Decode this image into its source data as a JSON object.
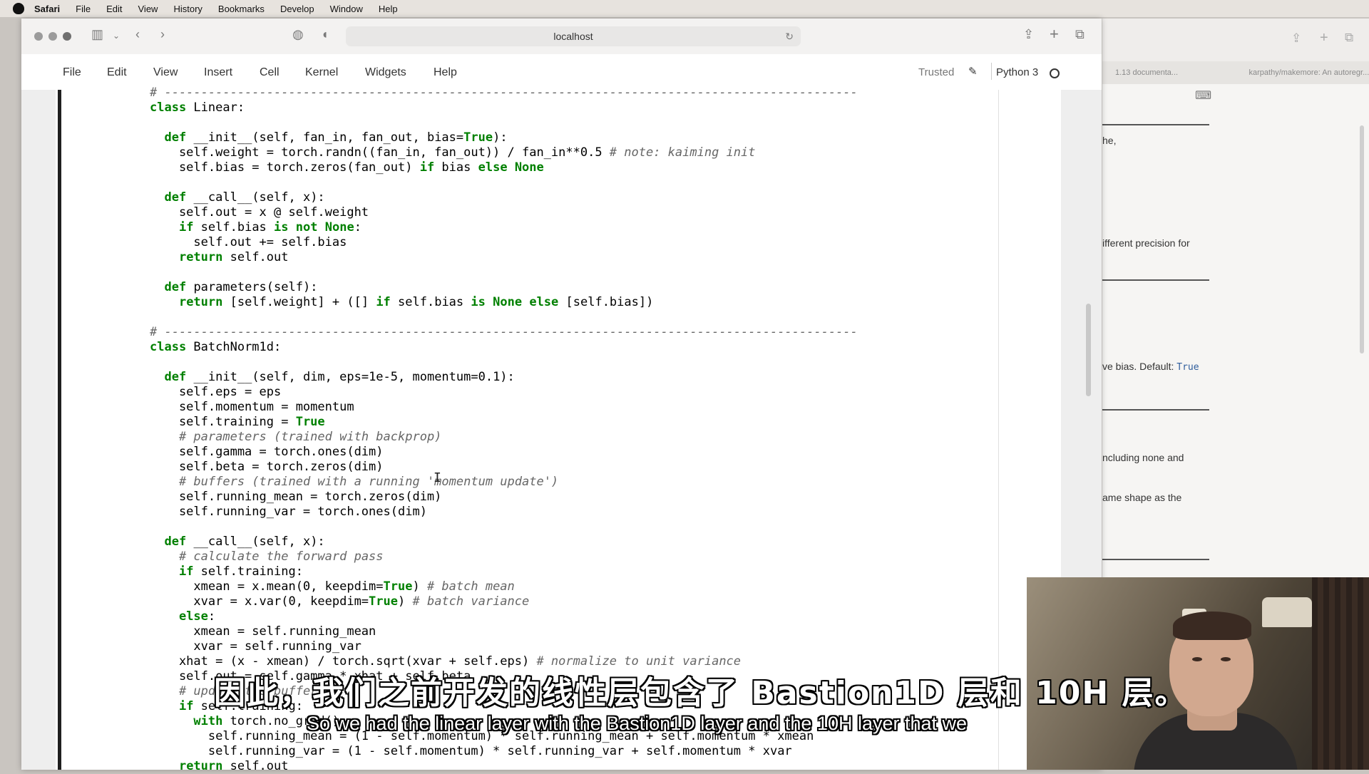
{
  "menubar": {
    "app": "Safari",
    "items": [
      "File",
      "Edit",
      "View",
      "History",
      "Bookmarks",
      "Develop",
      "Window",
      "Help"
    ]
  },
  "browser": {
    "address": "localhost"
  },
  "jupyter": {
    "menu": [
      "File",
      "Edit",
      "View",
      "Insert",
      "Cell",
      "Kernel",
      "Widgets",
      "Help"
    ],
    "trusted": "Trusted",
    "kernel": "Python 3"
  },
  "background_window": {
    "tabs": [
      "1.13 documenta...",
      "karpathy/makemore: An autoregr..."
    ],
    "fragments": [
      {
        "text": "he,"
      },
      {
        "text": "ifferent precision for"
      },
      {
        "text": "ve bias. Default: "
      },
      {
        "text": "True"
      },
      {
        "text": "ncluding none and"
      },
      {
        "text": "ame shape as the"
      }
    ]
  },
  "code": {
    "lines": [
      "# -----------------------------------------------------------------------------------------------",
      "class Linear:",
      "",
      "  def __init__(self, fan_in, fan_out, bias=True):",
      "    self.weight = torch.randn((fan_in, fan_out)) / fan_in**0.5 # note: kaiming init",
      "    self.bias = torch.zeros(fan_out) if bias else None",
      "",
      "  def __call__(self, x):",
      "    self.out = x @ self.weight",
      "    if self.bias is not None:",
      "      self.out += self.bias",
      "    return self.out",
      "",
      "  def parameters(self):",
      "    return [self.weight] + ([] if self.bias is None else [self.bias])",
      "",
      "# -----------------------------------------------------------------------------------------------",
      "class BatchNorm1d:",
      "",
      "  def __init__(self, dim, eps=1e-5, momentum=0.1):",
      "    self.eps = eps",
      "    self.momentum = momentum",
      "    self.training = True",
      "    # parameters (trained with backprop)",
      "    self.gamma = torch.ones(dim)",
      "    self.beta = torch.zeros(dim)",
      "    # buffers (trained with a running 'momentum update')",
      "    self.running_mean = torch.zeros(dim)",
      "    self.running_var = torch.ones(dim)",
      "",
      "  def __call__(self, x):",
      "    # calculate the forward pass",
      "    if self.training:",
      "      xmean = x.mean(0, keepdim=True) # batch mean",
      "      xvar = x.var(0, keepdim=True) # batch variance",
      "    else:",
      "      xmean = self.running_mean",
      "      xvar = self.running_var",
      "    xhat = (x - xmean) / torch.sqrt(xvar + self.eps) # normalize to unit variance",
      "    self.out = self.gamma * xhat + self.beta",
      "    # update the buffers",
      "    if self.training:",
      "      with torch.no_grad():",
      "        self.running_mean = (1 - self.momentum) * self.running_mean + self.momentum * xmean",
      "        self.running_var = (1 - self.momentum) * self.running_var + self.momentum * xvar",
      "    return self.out"
    ]
  },
  "subtitles": {
    "chinese": "因此，我们之前开发的线性层包含了 Bastion1D 层和 10H 层。",
    "english": "So we had the linear layer with the Bastion1D layer and the 10H layer that we"
  },
  "colors": {
    "keyword": "#008000",
    "comment": "#666666",
    "cell_bar": "#1f1f1f"
  }
}
